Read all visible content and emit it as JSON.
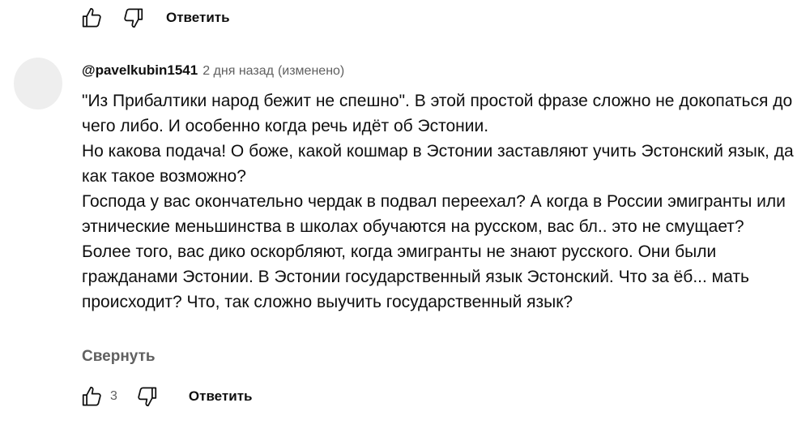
{
  "top_actions": {
    "like_icon": "thumbs-up-icon",
    "dislike_icon": "thumbs-down-icon",
    "reply_label": "Ответить"
  },
  "comment": {
    "author": "@pavelkubin1541",
    "time": "2 дня назад",
    "edited": "(изменено)",
    "paragraphs": [
      "\"Из Прибалтики народ бежит не спешно\". В этой простой фразе сложно не докопаться до чего либо. И особенно когда речь идёт об Эстонии.",
      "Но какова подача! О боже, какой кошмар в Эстонии заставляют учить Эстонский язык, да как такое возможно?",
      "Господа у вас окончательно чердак в подвал переехал? А когда в России эмигранты или этнические меньшинства в школах обучаются на русском, вас бл.. это не смущает?",
      "Более того, вас дико оскорбляют, когда эмигранты не знают русского. Они были гражданами Эстонии. В Эстонии государственный язык Эстонский. Что за ёб... мать происходит? Что, так сложно выучить государственный язык?"
    ],
    "collapse_label": "Свернуть",
    "like_count": "3",
    "reply_label": "Ответить"
  }
}
